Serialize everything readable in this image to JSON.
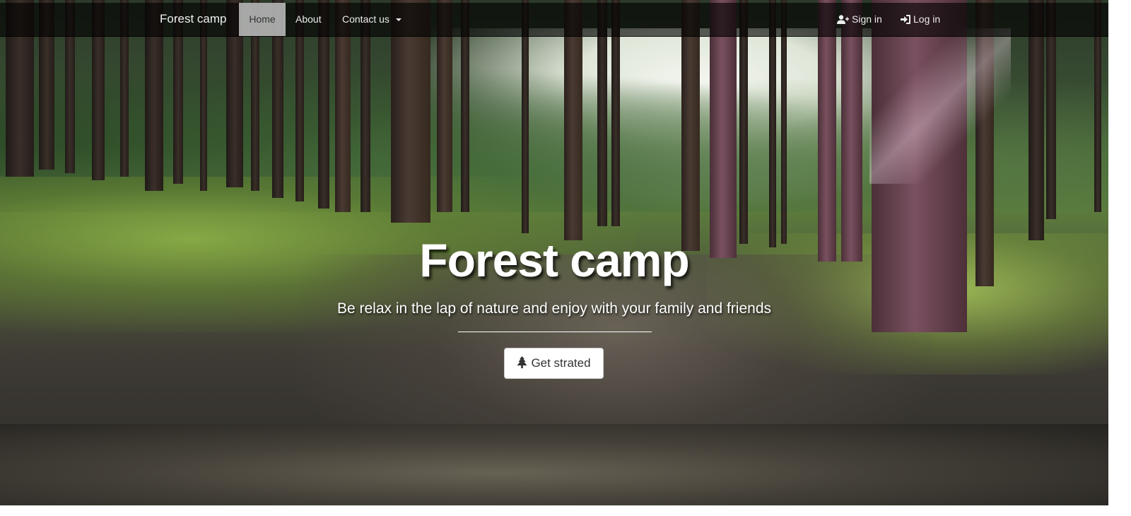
{
  "navbar": {
    "brand": "Forest camp",
    "items": [
      {
        "label": "Home",
        "active": true
      },
      {
        "label": "About",
        "active": false
      },
      {
        "label": "Contact us",
        "active": false,
        "dropdown": true
      }
    ],
    "right_items": [
      {
        "label": "Sign in",
        "icon": "user-plus-icon"
      },
      {
        "label": "Log in",
        "icon": "sign-in-icon"
      }
    ]
  },
  "hero": {
    "title": "Forest camp",
    "subtitle": "Be relax in the lap of nature and enjoy with your family and friends",
    "cta_label": "Get strated",
    "cta_icon": "tree-icon"
  },
  "colors": {
    "navbar_bg": "#000000",
    "active_tab_bg": "#d2d2d2",
    "text_light": "#ffffff",
    "button_bg": "#ffffff",
    "button_text": "#333333"
  }
}
